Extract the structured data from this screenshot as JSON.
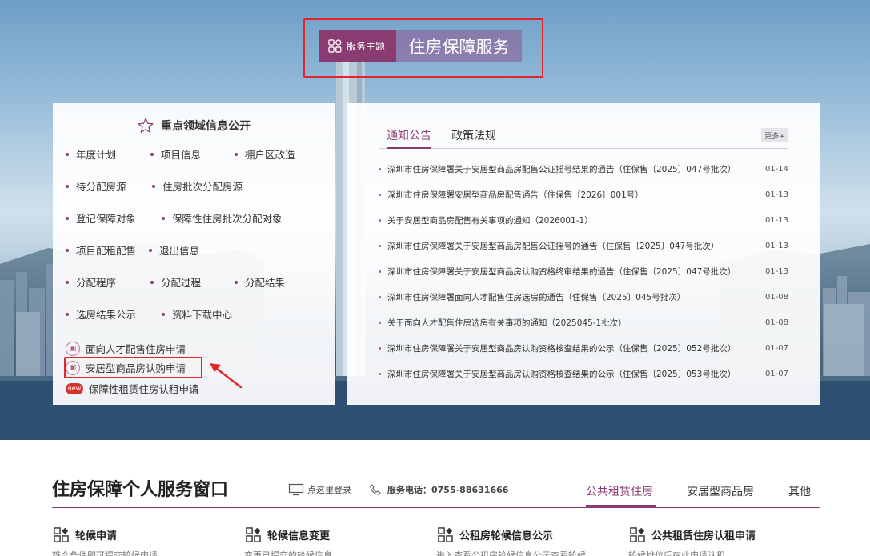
{
  "theme": {
    "tag": "服务主题",
    "title": "住房保障服务"
  },
  "key_areas": {
    "heading": "重点领域信息公开",
    "rows": [
      [
        "年度计划",
        "项目信息",
        "棚户区改造"
      ],
      [
        "待分配房源",
        "住房批次分配房源"
      ],
      [
        "登记保障对象",
        "保障性住房批次分配对象"
      ],
      [
        "项目配租配售",
        "退出信息"
      ],
      [
        "分配程序",
        "分配过程",
        "分配结果"
      ],
      [
        "选房结果公示",
        "资料下载中心"
      ]
    ],
    "applications": [
      {
        "label": "面向人才配售住房申请",
        "icon": "document-icon"
      },
      {
        "label": "安居型商品房认购申请",
        "icon": "document-icon"
      },
      {
        "label": "保障性租赁住房认租申请",
        "icon": "new-badge",
        "badge": "new"
      }
    ]
  },
  "notices": {
    "tabs": [
      "通知公告",
      "政策法规"
    ],
    "active_tab": "通知公告",
    "more_label": "更多+",
    "items": [
      {
        "title": "深圳市住房保障署关于安居型商品房配售公证摇号结果的通告（住保售〔2025〕047号批次）",
        "date": "01-14"
      },
      {
        "title": "深圳市住房保障署安居型商品房配售通告（住保售〔2026〕001号）",
        "date": "01-13"
      },
      {
        "title": "关于安居型商品房配售有关事项的通知（2026001-1）",
        "date": "01-13"
      },
      {
        "title": "深圳市住房保障署关于安居型商品房配售公证摇号的通告（住保售〔2025〕047号批次）",
        "date": "01-13"
      },
      {
        "title": "深圳市住房保障署关于安居型商品房认购资格终审结果的通告（住保售〔2025〕047号批次）",
        "date": "01-13"
      },
      {
        "title": "深圳市住房保障署面向人才配售住房选房的通告（住保售〔2025〕045号批次）",
        "date": "01-08"
      },
      {
        "title": "关于面向人才配售住房选房有关事项的通知（2025045-1批次）",
        "date": "01-08"
      },
      {
        "title": "深圳市住房保障署关于安居型商品房认购资格核查结果的公示（住保售〔2025〕052号批次）",
        "date": "01-07"
      },
      {
        "title": "深圳市住房保障署关于安居型商品房认购资格核查结果的公示（住保售〔2025〕053号批次）",
        "date": "01-07"
      }
    ]
  },
  "service_window": {
    "title": "住房保障个人服务窗口",
    "login_label": "点这里登录",
    "phone_label": "服务电话：0755-88631666",
    "tabs": [
      "公共租赁住房",
      "安居型商品房",
      "其他"
    ],
    "active_tab": "公共租赁住房",
    "items": [
      {
        "label": "轮候申请",
        "desc": "符合条件即可提交轮候申请"
      },
      {
        "label": "轮候信息变更",
        "desc": "变更已提交的轮候信息"
      },
      {
        "label": "公租房轮候信息公示",
        "desc": "进入查看公租房轮候信息公示查看轮候"
      },
      {
        "label": "公共租赁住房认租申请",
        "desc": "轮候排位后在此申请认租"
      }
    ]
  },
  "colors": {
    "accent": "#8a3c72",
    "highlight": "#e0262b"
  }
}
